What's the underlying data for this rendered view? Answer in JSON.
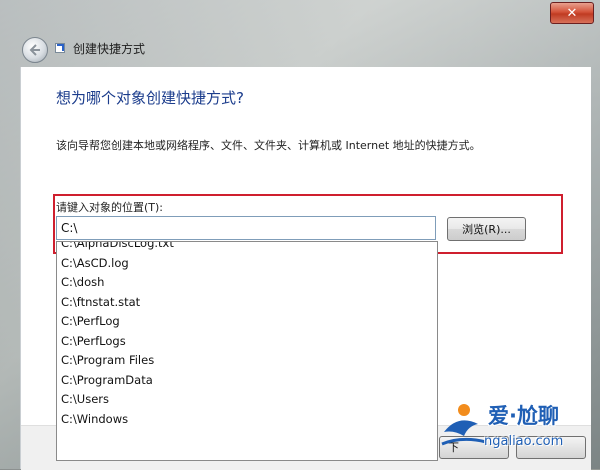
{
  "window": {
    "title": "创建快捷方式",
    "close_label": "✕"
  },
  "wizard": {
    "heading": "想为哪个对象创建快捷方式?",
    "description": "该向导帮您创建本地或网络程序、文件、文件夹、计算机或 Internet 地址的快捷方式。",
    "location_label": "请键入对象的位置(T):",
    "location_value": "C:\\",
    "browse_label": "浏览(R)...",
    "next_label": "下"
  },
  "autocomplete": {
    "items": [
      "C:\\AlphaDiscLog.txt",
      "C:\\AsCD.log",
      "C:\\dosh",
      "C:\\ftnstat.stat",
      "C:\\PerfLog",
      "C:\\PerfLogs",
      "C:\\Program Files",
      "C:\\ProgramData",
      "C:\\Users",
      "C:\\Windows"
    ]
  },
  "watermark": {
    "brand": "爱·尬聊",
    "domain": "ngaliao.com"
  },
  "colors": {
    "heading": "#1b3c8c",
    "highlight_border": "#cf1f2e",
    "close_button": "#c03b22",
    "watermark": "#1f5fb5"
  },
  "icons": {
    "back": "back-arrow-icon",
    "wizard": "shortcut-icon",
    "close": "close-icon"
  }
}
